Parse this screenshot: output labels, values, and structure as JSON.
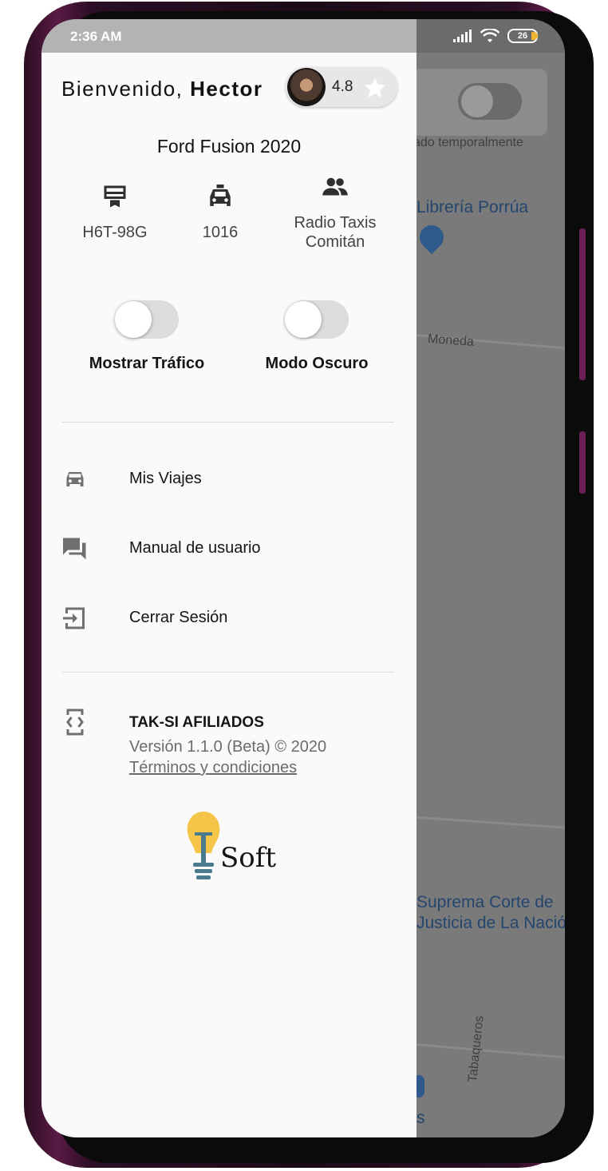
{
  "status_bar": {
    "time": "2:36 AM",
    "battery": "26"
  },
  "map": {
    "card_text": "ado temporalmente",
    "poi_1": "Librería Porrúa",
    "street_1": "Moneda",
    "poi_2_line1": "Suprema Corte de",
    "poi_2_line2": "Justicia de La Nació",
    "street_2": "Tabaqueros",
    "bottom_label": "s"
  },
  "drawer": {
    "welcome_prefix": "Bienvenido,",
    "user_name": "Hector",
    "rating": "4.8",
    "car_model": "Ford Fusion 2020",
    "stats": [
      {
        "icon": "license-plate-icon",
        "value": "H6T-98G"
      },
      {
        "icon": "taxi-icon",
        "value": "1016"
      },
      {
        "icon": "people-icon",
        "value_line1": "Radio Taxis",
        "value_line2": "Comitán"
      }
    ],
    "toggles": [
      {
        "label": "Mostrar Tráfico",
        "on": false
      },
      {
        "label": "Modo Oscuro",
        "on": false
      }
    ],
    "menu": [
      {
        "icon": "car-icon",
        "label": "Mis Viajes"
      },
      {
        "icon": "chat-icon",
        "label": "Manual de usuario"
      },
      {
        "icon": "logout-icon",
        "label": "Cerrar Sesión"
      }
    ],
    "about": {
      "icon": "developer-mode-icon",
      "title": "TAK-SI AFILIADOS",
      "version": "Versión 1.1.0 (Beta) © 2020",
      "terms": "Términos y condiciones"
    },
    "logo_text": "Soft"
  },
  "colors": {
    "drawer_bg": "#fafafa",
    "icon_gray": "#707070",
    "phone_frame": "#5a1a45",
    "logo_bulb": "#f5c54a",
    "logo_base": "#4a7a8c"
  }
}
